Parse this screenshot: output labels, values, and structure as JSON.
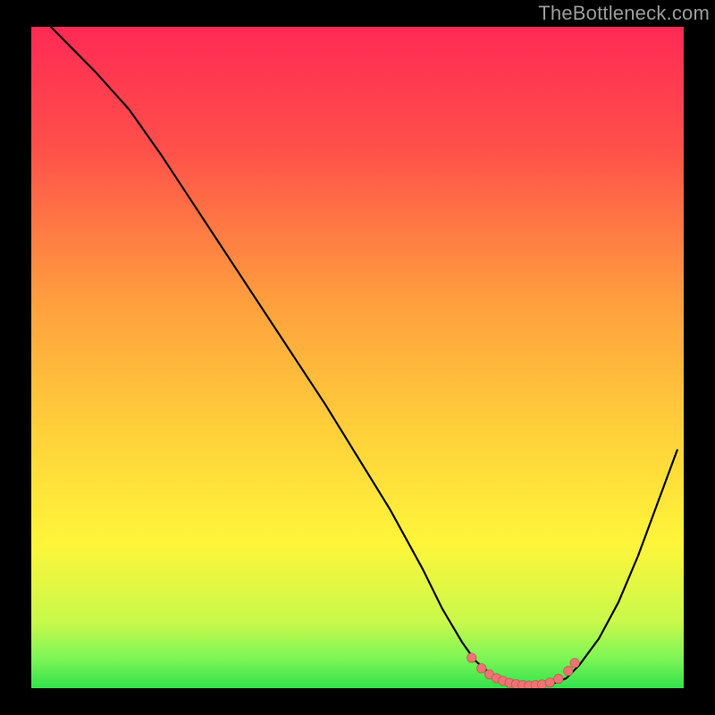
{
  "watermark": "TheBottleneck.com",
  "colors": {
    "curve": "#000000",
    "markers_fill": "#ef7373",
    "markers_stroke": "#b94b4b",
    "green_band": "#33e24c",
    "background_black": "#000000"
  },
  "chart_data": {
    "type": "line",
    "title": "",
    "xlabel": "",
    "ylabel": "",
    "xlim": [
      0,
      100
    ],
    "ylim": [
      0,
      100
    ],
    "gradient_stops": [
      {
        "offset": 0.0,
        "color": "#ff2a55"
      },
      {
        "offset": 0.18,
        "color": "#ff4f4a"
      },
      {
        "offset": 0.42,
        "color": "#ffa03e"
      },
      {
        "offset": 0.62,
        "color": "#ffd23a"
      },
      {
        "offset": 0.78,
        "color": "#fff53a"
      },
      {
        "offset": 0.9,
        "color": "#c8f94a"
      },
      {
        "offset": 0.955,
        "color": "#7df556"
      },
      {
        "offset": 1.0,
        "color": "#33e24c"
      }
    ],
    "series": [
      {
        "name": "bottleneck-curve",
        "x": [
          3,
          6,
          10,
          15,
          20,
          25,
          30,
          35,
          40,
          45,
          50,
          55,
          60,
          63,
          66,
          68,
          70,
          72,
          74,
          76,
          78,
          80,
          82,
          84,
          87,
          90,
          93,
          96,
          99
        ],
        "y": [
          100,
          97,
          93,
          87.5,
          80.5,
          73,
          65.5,
          58,
          50.5,
          43,
          35,
          27,
          18,
          12,
          7,
          4.2,
          2.5,
          1.4,
          0.7,
          0.4,
          0.4,
          0.7,
          1.5,
          3.5,
          7.5,
          13,
          20,
          28,
          36
        ]
      }
    ],
    "markers": {
      "name": "optimal-range-markers",
      "x": [
        67.5,
        69,
        70.2,
        71.3,
        72.3,
        73.3,
        74.3,
        75.3,
        76.3,
        77.3,
        78.3,
        79.5,
        80.8,
        82.3,
        83.3
      ],
      "y": [
        4.6,
        3.0,
        2.1,
        1.5,
        1.1,
        0.8,
        0.6,
        0.45,
        0.4,
        0.45,
        0.55,
        0.85,
        1.4,
        2.6,
        3.8
      ]
    }
  }
}
